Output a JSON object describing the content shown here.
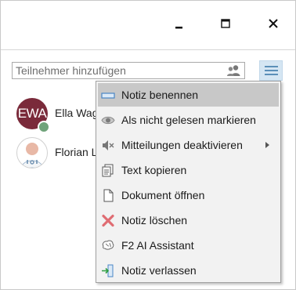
{
  "window": {
    "controls": [
      {
        "name": "minimize-icon",
        "glyph": "minimize"
      },
      {
        "name": "maximize-icon",
        "glyph": "maximize"
      },
      {
        "name": "close-icon",
        "glyph": "close"
      }
    ]
  },
  "search": {
    "placeholder": "Teilnehmer hinzufügen",
    "icon": "add-participants-icon"
  },
  "menu_button": {
    "icon": "hamburger-menu-icon",
    "color": "#5b8fb8"
  },
  "participants": [
    {
      "name": "Ella Wag",
      "avatar_text": "EWA",
      "avatar_color": "#7a2a3a",
      "status_color": "#6fa37a"
    },
    {
      "name": "Florian L",
      "avatar_icon": "user-avatar-icon"
    }
  ],
  "context_menu": {
    "items": [
      {
        "label": "Notiz benennen",
        "icon": "rename-icon",
        "highlighted": true
      },
      {
        "label": "Als nicht gelesen markieren",
        "icon": "eye-icon"
      },
      {
        "label": "Mitteilungen deaktivieren",
        "icon": "mute-icon",
        "submenu": true
      },
      {
        "label": "Text kopieren",
        "icon": "copy-icon"
      },
      {
        "label": "Dokument öffnen",
        "icon": "document-icon"
      },
      {
        "label": "Notiz löschen",
        "icon": "delete-icon"
      },
      {
        "label": "F2 AI Assistant",
        "icon": "ai-brain-icon"
      },
      {
        "label": "Notiz verlassen",
        "icon": "leave-icon"
      }
    ]
  }
}
